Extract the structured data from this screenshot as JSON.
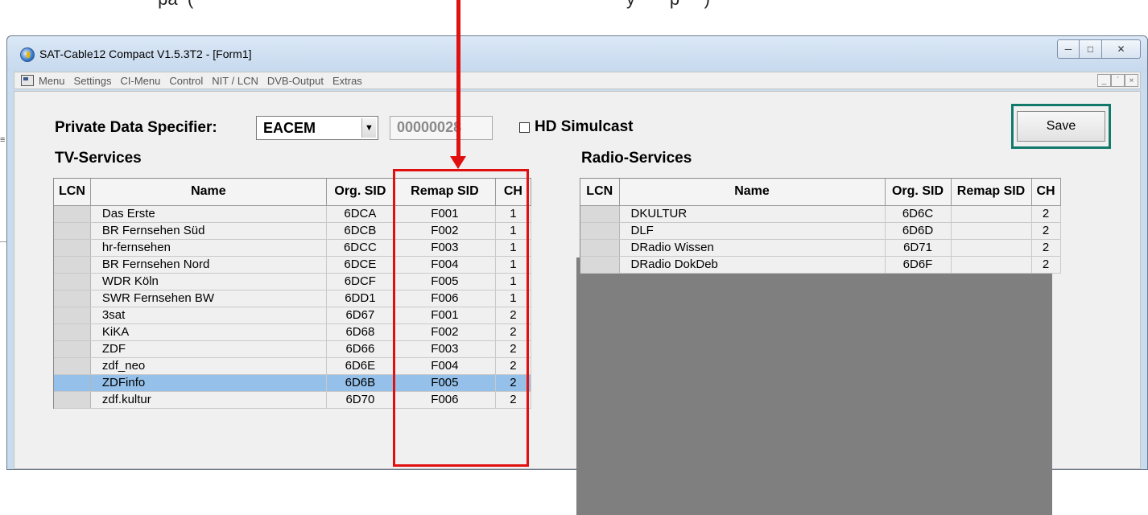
{
  "top_fragment": "                   pa  (                                                                                        y       p     )",
  "window": {
    "title": "SAT-Cable12 Compact V1.5.3T2 - [Form1]",
    "buttons": {
      "minimize": "─",
      "maximize": "□",
      "close": "✕"
    }
  },
  "menubar": {
    "items": [
      "Menu",
      "Settings",
      "CI-Menu",
      "Control",
      "NIT / LCN",
      "DVB-Output",
      "Extras"
    ],
    "mdi": {
      "minimize": "_",
      "restore": "΄",
      "close": "×"
    }
  },
  "form": {
    "pds_label": "Private Data Specifier:",
    "pds_select_value": "EACEM",
    "pds_value": "00000028",
    "hd_simulcast_label": "HD Simulcast",
    "save_label": "Save"
  },
  "tv_services": {
    "title": "TV-Services",
    "columns": [
      "LCN",
      "Name",
      "Org. SID",
      "Remap SID",
      "CH"
    ],
    "rows": [
      {
        "lcn": "",
        "name": "Das Erste",
        "org_sid": "6DCA",
        "remap_sid": "F001",
        "ch": "1"
      },
      {
        "lcn": "",
        "name": "BR Fernsehen Süd",
        "org_sid": "6DCB",
        "remap_sid": "F002",
        "ch": "1"
      },
      {
        "lcn": "",
        "name": "hr-fernsehen",
        "org_sid": "6DCC",
        "remap_sid": "F003",
        "ch": "1"
      },
      {
        "lcn": "",
        "name": "BR Fernsehen Nord",
        "org_sid": "6DCE",
        "remap_sid": "F004",
        "ch": "1"
      },
      {
        "lcn": "",
        "name": "WDR Köln",
        "org_sid": "6DCF",
        "remap_sid": "F005",
        "ch": "1"
      },
      {
        "lcn": "",
        "name": "SWR Fernsehen BW",
        "org_sid": "6DD1",
        "remap_sid": "F006",
        "ch": "1"
      },
      {
        "lcn": "",
        "name": "3sat",
        "org_sid": "6D67",
        "remap_sid": "F001",
        "ch": "2"
      },
      {
        "lcn": "",
        "name": "KiKA",
        "org_sid": "6D68",
        "remap_sid": "F002",
        "ch": "2"
      },
      {
        "lcn": "",
        "name": "ZDF",
        "org_sid": "6D66",
        "remap_sid": "F003",
        "ch": "2"
      },
      {
        "lcn": "",
        "name": "zdf_neo",
        "org_sid": "6D6E",
        "remap_sid": "F004",
        "ch": "2"
      },
      {
        "lcn": "",
        "name": "ZDFinfo",
        "org_sid": "6D6B",
        "remap_sid": "F005",
        "ch": "2",
        "selected": true
      },
      {
        "lcn": "",
        "name": "zdf.kultur",
        "org_sid": "6D70",
        "remap_sid": "F006",
        "ch": "2"
      }
    ]
  },
  "radio_services": {
    "title": "Radio-Services",
    "columns": [
      "LCN",
      "Name",
      "Org. SID",
      "Remap SID",
      "CH"
    ],
    "rows": [
      {
        "lcn": "",
        "name": "DKULTUR",
        "org_sid": "6D6C",
        "remap_sid": "",
        "ch": "2"
      },
      {
        "lcn": "",
        "name": "DLF",
        "org_sid": "6D6D",
        "remap_sid": "",
        "ch": "2"
      },
      {
        "lcn": "",
        "name": "DRadio Wissen",
        "org_sid": "6D71",
        "remap_sid": "",
        "ch": "2"
      },
      {
        "lcn": "",
        "name": "DRadio DokDeb",
        "org_sid": "6D6F",
        "remap_sid": "",
        "ch": "2"
      }
    ]
  },
  "colors": {
    "annotation_red": "#e01010",
    "save_highlight": "#127a6b",
    "selection": "#94c0ea"
  }
}
